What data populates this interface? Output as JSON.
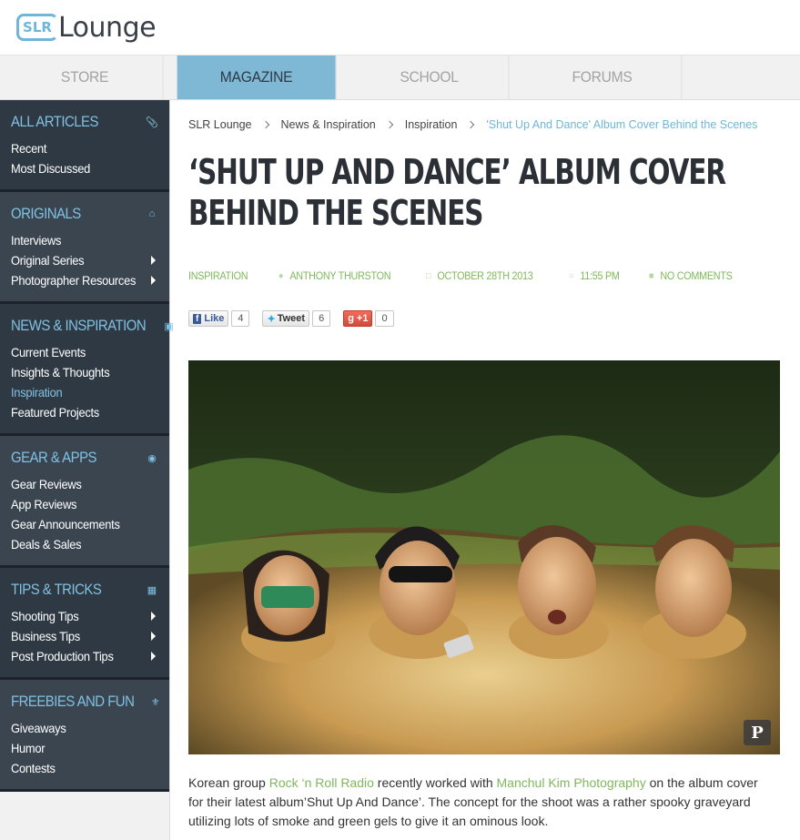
{
  "logo": {
    "slr": "SLR",
    "word": "Lounge"
  },
  "nav": [
    {
      "label": "STORE"
    },
    {
      "label": "MAGAZINE"
    },
    {
      "label": "SCHOOL"
    },
    {
      "label": "FORUMS"
    }
  ],
  "sidebar": {
    "all_articles": {
      "title": "ALL ARTICLES",
      "icon": "paperclip-icon",
      "links": [
        "Recent",
        "Most Discussed"
      ]
    },
    "originals": {
      "title": "ORIGINALS",
      "icon": "home-icon",
      "links": [
        "Interviews",
        "Original Series",
        "Photographer Resources"
      ]
    },
    "news": {
      "title": "NEWS & INSPIRATION",
      "icon": "news-icon",
      "links": [
        "Current Events",
        "Insights & Thoughts",
        "Inspiration",
        "Featured Projects"
      ]
    },
    "gear": {
      "title": "GEAR & APPS",
      "icon": "camera-icon",
      "links": [
        "Gear Reviews",
        "App Reviews",
        "Gear Announcements",
        "Deals & Sales"
      ]
    },
    "tips": {
      "title": "TIPS & TRICKS",
      "icon": "picture-icon",
      "links": [
        "Shooting Tips",
        "Business Tips",
        "Post Production Tips"
      ]
    },
    "freebies": {
      "title": "FREEBIES AND FUN",
      "icon": "trophy-icon",
      "links": [
        "Giveaways",
        "Humor",
        "Contests"
      ]
    }
  },
  "breadcrumb": [
    "SLR Lounge",
    "News & Inspiration",
    "Inspiration",
    "'Shut Up And Dance' Album Cover Behind the Scenes"
  ],
  "article": {
    "title_line1": "‘SHUT UP AND DANCE’ ALBUM COVER",
    "title_line2": "BEHIND THE SCENES",
    "category": "INSPIRATION",
    "author": "ANTHONY THURSTON",
    "date": "OCTOBER 28TH 2013",
    "time": "11:55 PM",
    "comments": "NO COMMENTS"
  },
  "social": {
    "like_label": "Like",
    "like_count": "4",
    "tweet_label": "Tweet",
    "tweet_count": "6",
    "plus_label": "+1",
    "plus_count": "0"
  },
  "body": {
    "p1_a": "Korean group ",
    "link1": "Rock ‘n Roll Radio",
    "p1_b": " recently worked with ",
    "link2": "Manchul Kim Photography",
    "p1_c": " on the album cover for their latest album’Shut Up And Dance’. The concept for the shoot was a rather spooky graveyard utilizing lots of smoke and green gels to give it an ominous look."
  },
  "colors": {
    "accent_blue": "#7fc1e3",
    "accent_green": "#7fb85b",
    "sidebar_dark": "#2f3943"
  }
}
